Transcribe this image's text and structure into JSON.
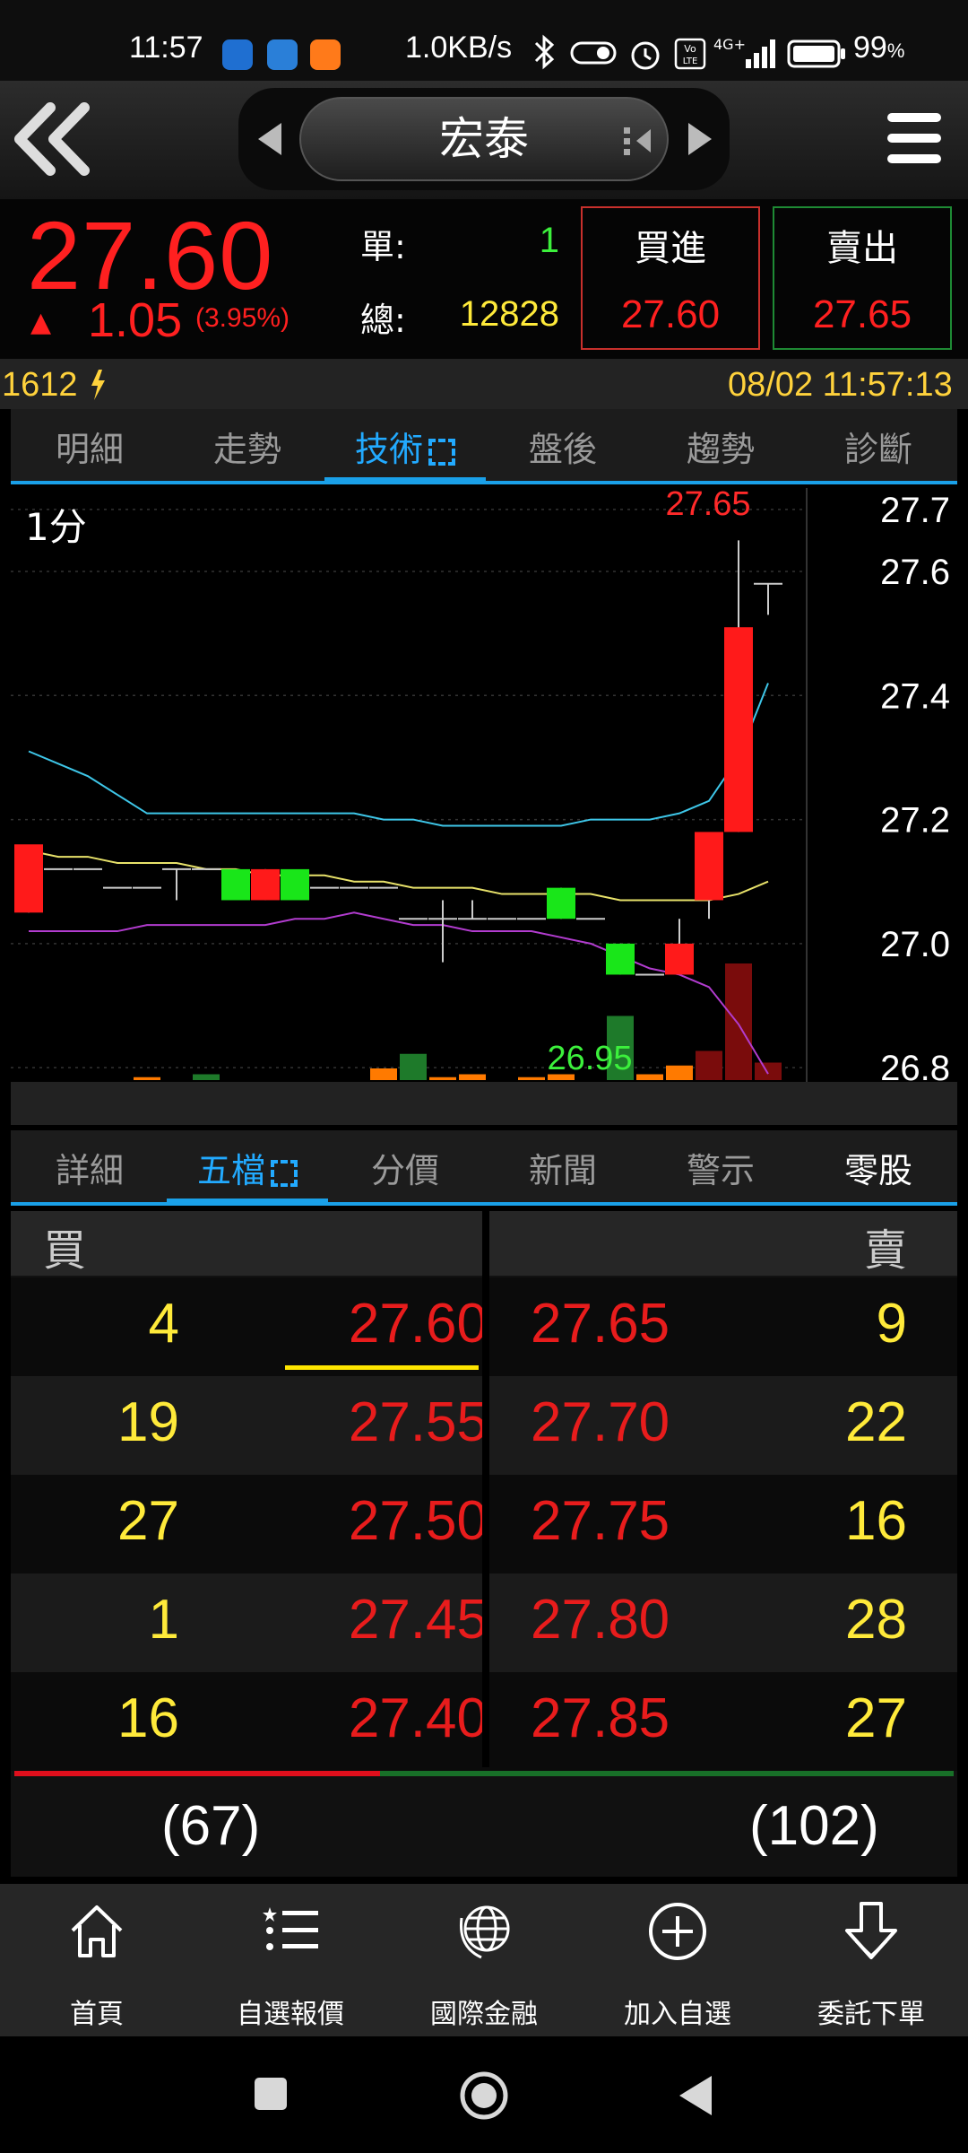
{
  "status_bar": {
    "time": "11:57",
    "network_speed": "1.0KB/s",
    "signal": "4G+",
    "battery": "99",
    "battery_unit": "%"
  },
  "header": {
    "stock_name": "宏泰"
  },
  "quote": {
    "price": "27.60",
    "change_arrow": "▲",
    "change": "1.05",
    "change_pct": "(3.95%)",
    "single_label": "單:",
    "single_value": "1",
    "total_label": "總:",
    "total_value": "12828",
    "buy_label": "買進",
    "buy_price": "27.60",
    "sell_label": "賣出",
    "sell_price": "27.65"
  },
  "info_row": {
    "stock_code": "1612",
    "datetime": "08/02 11:57:13"
  },
  "chart_tabs": [
    "明細",
    "走勢",
    "技術",
    "盤後",
    "趨勢",
    "診斷"
  ],
  "chart_active_tab": 2,
  "chart_data": {
    "type": "candlestick",
    "interval_label": "1分",
    "y_ticks": [
      "27.7",
      "27.6",
      "27.4",
      "27.2",
      "27.0",
      "26.8"
    ],
    "y_tick_values": [
      27.7,
      27.6,
      27.4,
      27.2,
      27.0,
      26.8
    ],
    "ylim": [
      26.78,
      27.72
    ],
    "max_label": "27.65",
    "min_label": "26.95",
    "grid": true,
    "candles": [
      {
        "o": 27.05,
        "h": 27.12,
        "l": 27.05,
        "c": 27.16
      },
      {
        "o": 27.12,
        "h": 27.12,
        "l": 27.12,
        "c": 27.12
      },
      {
        "o": 27.12,
        "h": 27.12,
        "l": 27.12,
        "c": 27.12
      },
      {
        "o": 27.09,
        "h": 27.09,
        "l": 27.09,
        "c": 27.09
      },
      {
        "o": 27.09,
        "h": 27.09,
        "l": 27.09,
        "c": 27.09
      },
      {
        "o": 27.12,
        "h": 27.12,
        "l": 27.07,
        "c": 27.12
      },
      {
        "o": 27.12,
        "h": 27.12,
        "l": 27.12,
        "c": 27.12
      },
      {
        "o": 27.12,
        "h": 27.12,
        "l": 27.12,
        "c": 27.07
      },
      {
        "o": 27.07,
        "h": 27.12,
        "l": 27.07,
        "c": 27.12
      },
      {
        "o": 27.12,
        "h": 27.12,
        "l": 27.12,
        "c": 27.07
      },
      {
        "o": 27.09,
        "h": 27.09,
        "l": 27.09,
        "c": 27.09
      },
      {
        "o": 27.09,
        "h": 27.09,
        "l": 27.09,
        "c": 27.09
      },
      {
        "o": 27.09,
        "h": 27.09,
        "l": 27.09,
        "c": 27.09
      },
      {
        "o": 27.04,
        "h": 27.04,
        "l": 27.04,
        "c": 27.04
      },
      {
        "o": 27.04,
        "h": 27.07,
        "l": 26.97,
        "c": 27.04
      },
      {
        "o": 27.04,
        "h": 27.07,
        "l": 27.04,
        "c": 27.04
      },
      {
        "o": 27.04,
        "h": 27.04,
        "l": 27.04,
        "c": 27.04
      },
      {
        "o": 27.04,
        "h": 27.04,
        "l": 27.04,
        "c": 27.04
      },
      {
        "o": 27.09,
        "h": 27.09,
        "l": 27.04,
        "c": 27.04
      },
      {
        "o": 27.04,
        "h": 27.04,
        "l": 27.04,
        "c": 27.04
      },
      {
        "o": 27.0,
        "h": 27.0,
        "l": 26.95,
        "c": 26.95
      },
      {
        "o": 26.95,
        "h": 26.95,
        "l": 26.95,
        "c": 26.95
      },
      {
        "o": 26.95,
        "h": 27.04,
        "l": 26.95,
        "c": 27.0
      },
      {
        "o": 27.07,
        "h": 27.07,
        "l": 27.04,
        "c": 27.18
      },
      {
        "o": 27.18,
        "h": 27.65,
        "l": 27.18,
        "c": 27.51
      },
      {
        "o": 27.58,
        "h": 27.58,
        "l": 27.53,
        "c": 27.58
      }
    ],
    "ma_fast": [
      27.31,
      27.29,
      27.27,
      27.24,
      27.21,
      27.21,
      27.21,
      27.21,
      27.21,
      27.21,
      27.21,
      27.21,
      27.2,
      27.2,
      27.19,
      27.19,
      27.19,
      27.19,
      27.19,
      27.2,
      27.2,
      27.2,
      27.21,
      27.23,
      27.3,
      27.42
    ],
    "ma_mid": [
      27.15,
      27.14,
      27.14,
      27.13,
      27.13,
      27.13,
      27.12,
      27.12,
      27.11,
      27.11,
      27.11,
      27.1,
      27.1,
      27.09,
      27.09,
      27.09,
      27.08,
      27.08,
      27.08,
      27.08,
      27.07,
      27.07,
      27.07,
      27.07,
      27.08,
      27.1
    ],
    "ma_slow": [
      27.02,
      27.02,
      27.02,
      27.02,
      27.03,
      27.03,
      27.03,
      27.03,
      27.03,
      27.04,
      27.04,
      27.05,
      27.04,
      27.03,
      27.03,
      27.02,
      27.02,
      27.02,
      27.01,
      27.0,
      26.98,
      26.96,
      26.95,
      26.93,
      26.87,
      26.79
    ],
    "volumes": [
      0,
      0,
      0,
      0,
      1,
      0,
      2,
      0,
      0,
      0,
      0,
      0,
      4,
      9,
      1,
      2,
      0,
      1,
      2,
      0,
      22,
      2,
      5,
      10,
      40,
      6
    ],
    "volume_colors": [
      "#ff7a00",
      "#ff7a00",
      "#ff7a00",
      "#c0392b",
      "#ff7a00",
      "#ff7a00",
      "#1e7a2a",
      "#ff7a00",
      "#ff7a00",
      "#ff7a00",
      "#ff7a00",
      "#ff7a00",
      "#ff7a00",
      "#1e7a2a",
      "#ff7a00",
      "#ff7a00",
      "#ff7a00",
      "#ff7a00",
      "#ff7a00",
      "#ff7a00",
      "#1e7a2a",
      "#ff7a00",
      "#ff7a00",
      "#7a0c0c",
      "#7a0c0c",
      "#7a0c0c"
    ],
    "colors": {
      "up": "#ff1a1a",
      "down": "#19e619",
      "ma_fast": "#3ec6e8",
      "ma_mid": "#e8e26a",
      "ma_slow": "#b23ccf"
    }
  },
  "book_tabs": [
    "詳細",
    "五檔",
    "分價",
    "新聞",
    "警示",
    "零股"
  ],
  "book_active_tab": 1,
  "order_book": {
    "bid_header": "買",
    "ask_header": "賣",
    "rows": [
      {
        "bid_qty": "4",
        "bid_price": "27.60",
        "ask_price": "27.65",
        "ask_qty": "9"
      },
      {
        "bid_qty": "19",
        "bid_price": "27.55",
        "ask_price": "27.70",
        "ask_qty": "22"
      },
      {
        "bid_qty": "27",
        "bid_price": "27.50",
        "ask_price": "27.75",
        "ask_qty": "16"
      },
      {
        "bid_qty": "1",
        "bid_price": "27.45",
        "ask_price": "27.80",
        "ask_qty": "28"
      },
      {
        "bid_qty": "16",
        "bid_price": "27.40",
        "ask_price": "27.85",
        "ask_qty": "27"
      }
    ],
    "bid_total": "(67)",
    "ask_total": "(102)"
  },
  "bottom_nav": [
    {
      "label": "首頁",
      "icon": "home-icon"
    },
    {
      "label": "自選報價",
      "icon": "list-star-icon"
    },
    {
      "label": "國際金融",
      "icon": "globe-icon"
    },
    {
      "label": "加入自選",
      "icon": "plus-circle-icon"
    },
    {
      "label": "委託下單",
      "icon": "down-arrow-icon"
    }
  ],
  "colors": {
    "accent": "#1aa0e8",
    "price_red": "#ff2020",
    "qty_yellow": "#ffea3a"
  }
}
